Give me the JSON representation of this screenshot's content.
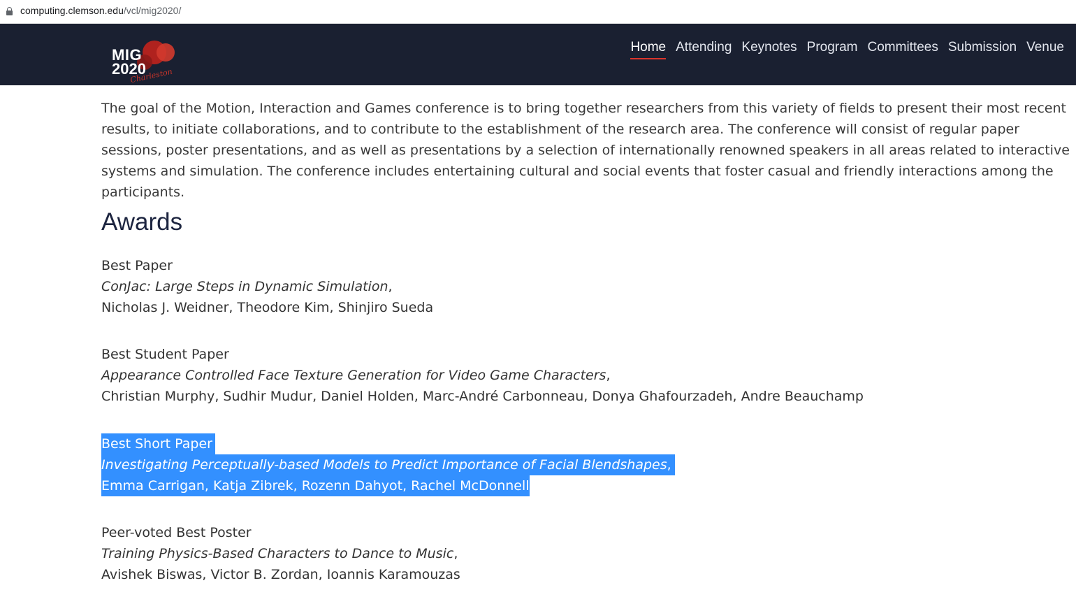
{
  "browser": {
    "url_host": "computing.clemson.edu",
    "url_path": "/vcl/mig2020/"
  },
  "site": {
    "logo_line1": "MIG",
    "logo_line2": "2020",
    "logo_script": "Charleston",
    "nav": [
      {
        "label": "Home",
        "active": true
      },
      {
        "label": "Attending"
      },
      {
        "label": "Keynotes"
      },
      {
        "label": "Program"
      },
      {
        "label": "Committees"
      },
      {
        "label": "Submission"
      },
      {
        "label": "Venue"
      }
    ]
  },
  "content": {
    "intro": "The goal of the Motion, Interaction and Games conference is to bring together researchers from this variety of fields to present their most recent results, to initiate collaborations, and to contribute to the establishment of the research area. The conference will consist of regular paper sessions, poster presentations, and as well as presentations by a selection of internationally renowned speakers in all areas related to interactive systems and simulation. The conference includes entertaining cultural and social events that foster casual and friendly interactions among the participants.",
    "awards_title": "Awards",
    "awards": [
      {
        "category": "Best Paper",
        "paper": "ConJac: Large Steps in Dynamic Simulation",
        "authors": "Nicholas J. Weidner, Theodore Kim, Shinjiro Sueda"
      },
      {
        "category": "Best Student Paper",
        "paper": "Appearance Controlled Face Texture Generation for Video Game Characters",
        "authors": "Christian Murphy, Sudhir Mudur, Daniel Holden, Marc-André Carbonneau, Donya Ghafourzadeh, Andre Beauchamp"
      },
      {
        "category": "Best Short Paper",
        "paper": "Investigating Perceptually-based Models to Predict Importance of Facial Blendshapes",
        "authors": "Emma Carrigan, Katja Zibrek, Rozenn Dahyot, Rachel McDonnell",
        "selected": true
      },
      {
        "category": "Peer-voted Best Poster",
        "paper": "Training Physics-Based Characters to Dance to Music",
        "authors": "Avishek Biswas, Victor B. Zordan, Ioannis Karamouzas"
      }
    ]
  }
}
